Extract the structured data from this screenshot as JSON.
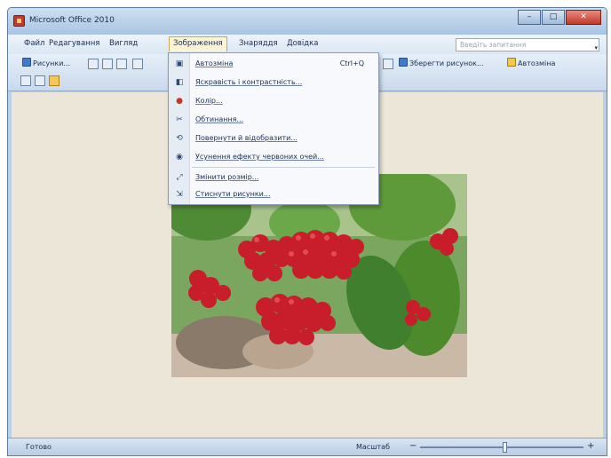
{
  "window": {
    "title": "Microsoft Office 2010",
    "buttons": [
      "–",
      "□",
      "✕"
    ]
  },
  "menubar": {
    "items": [
      "Файл",
      "Редагування",
      "Вигляд",
      "Зображення",
      "Знаряддя",
      "Довідка"
    ],
    "active_index": 3,
    "help_placeholder": "Введіть запитання"
  },
  "toolbar": {
    "row1": [
      "Рисунки...",
      "Зберегти рисунок...",
      "Автозміна"
    ],
    "row1_icons": [
      "pictures-icon",
      "save-picture-icon",
      "autocorrect-icon"
    ]
  },
  "dropdown": {
    "items": [
      {
        "label": "Автозміна",
        "shortcut": "Ctrl+Q",
        "icon": "autocorrect-icon",
        "glyph": "▣"
      },
      {
        "label": "Яскравість і контрастність...",
        "shortcut": "",
        "icon": "brightness-contrast-icon",
        "glyph": "◧"
      },
      {
        "label": "Колір...",
        "shortcut": "",
        "icon": "color-icon",
        "glyph": "●"
      },
      {
        "label": "Обтинання...",
        "shortcut": "",
        "icon": "crop-icon",
        "glyph": "✂"
      },
      {
        "label": "Повернути й відобразити...",
        "shortcut": "",
        "icon": "rotate-flip-icon",
        "glyph": "⟲"
      },
      {
        "label": "Усунення ефекту червоних очей...",
        "shortcut": "",
        "icon": "red-eye-icon",
        "glyph": "◉"
      },
      {
        "label": "Змінити розмір...",
        "shortcut": "",
        "icon": "resize-icon",
        "glyph": "⤢"
      },
      {
        "label": "Стиснути рисунки...",
        "shortcut": "",
        "icon": "compress-icon",
        "glyph": "⇲"
      }
    ]
  },
  "picture": {
    "subject": "viburnum-berries-image"
  },
  "statusbar": {
    "left_text": "Готово",
    "zoom_label": "Масштаб",
    "zoom_fraction": 0.52
  },
  "colors": {
    "berry_red": "#d2202f",
    "leaf_green": "#3f7f2e",
    "canvas": "#ebe6d8",
    "title_blue": "#a9c4e2"
  }
}
